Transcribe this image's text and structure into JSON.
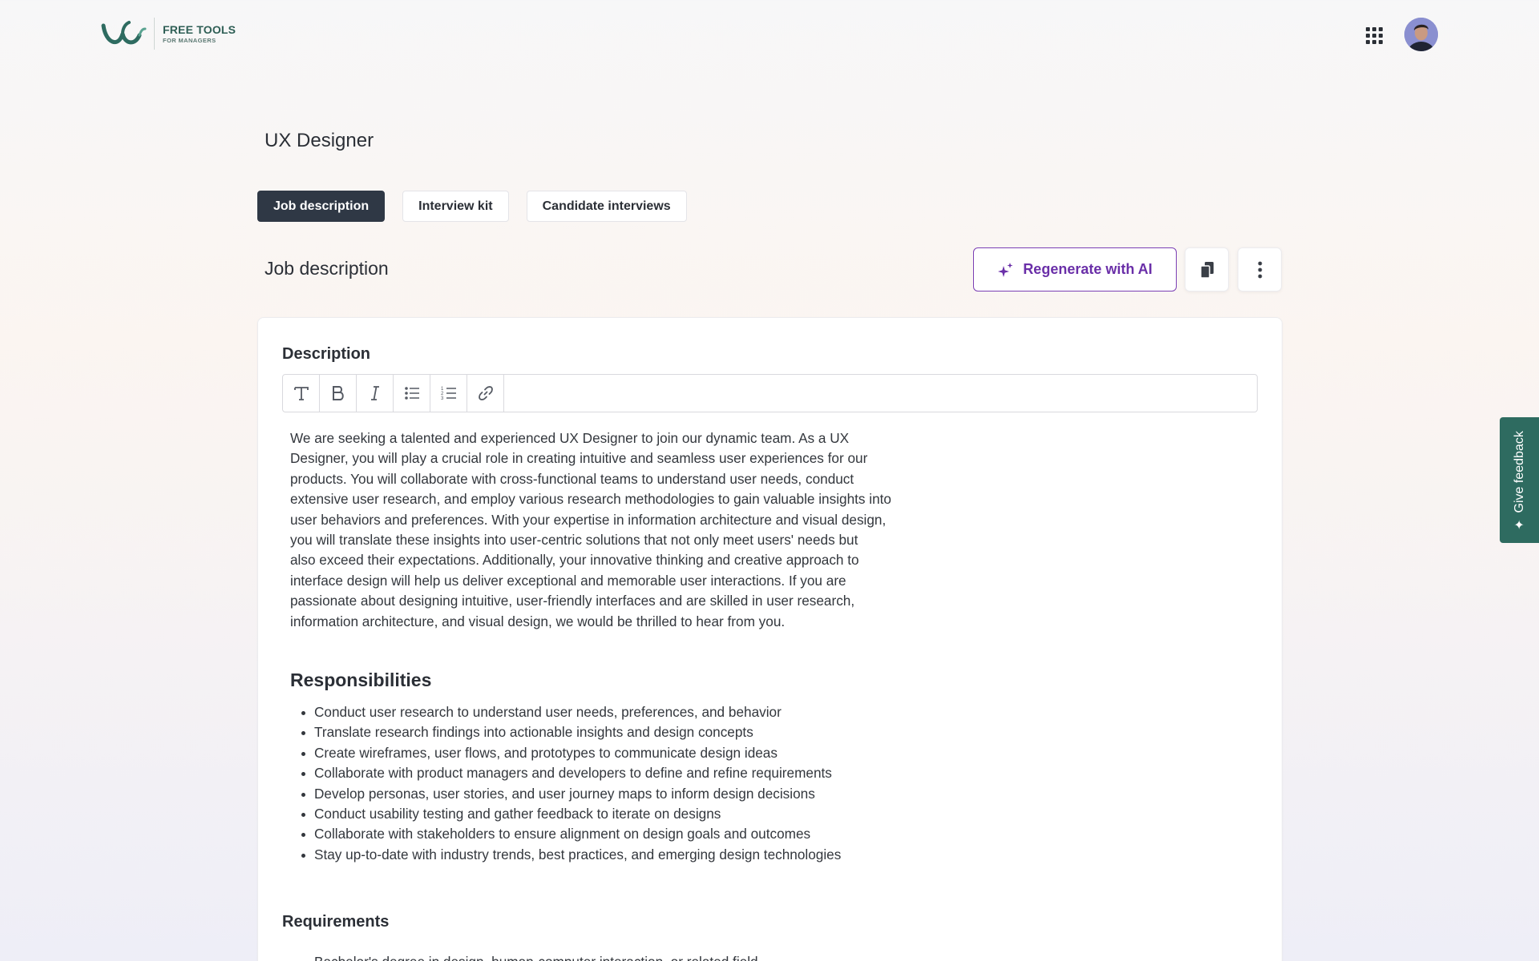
{
  "brand": {
    "title": "FREE TOOLS",
    "subtitle": "FOR MANAGERS",
    "color": "#2e6b60"
  },
  "header": {
    "apps_icon": "grid-icon",
    "avatar": "user-avatar"
  },
  "page": {
    "title": "UX Designer"
  },
  "tabs": [
    {
      "label": "Job description",
      "active": true
    },
    {
      "label": "Interview kit",
      "active": false
    },
    {
      "label": "Candidate interviews",
      "active": false
    }
  ],
  "section": {
    "title": "Job description",
    "regenerate_label": "Regenerate with AI",
    "accent": "#6a2fa8"
  },
  "editor": {
    "label": "Description",
    "toolbar": [
      "text-style-icon",
      "bold-icon",
      "italic-icon",
      "bullet-list-icon",
      "numbered-list-icon",
      "link-icon"
    ],
    "intro_lines": [
      "We are seeking a talented and experienced UX Designer to join our dynamic team. As a UX",
      "Designer, you will play a crucial role in creating intuitive and seamless user experiences for our",
      "products. You will collaborate with cross-functional teams to understand user needs, conduct",
      "extensive user research, and employ various research methodologies to gain valuable insights into",
      "user behaviors and preferences. With your expertise in information architecture and visual design,",
      "you will translate these insights into user-centric solutions that not only meet users' needs but",
      "also exceed their expectations. Additionally, your innovative thinking and creative approach to",
      "interface design will help us deliver exceptional and memorable user interactions. If you are",
      "passionate about designing intuitive, user-friendly interfaces and are skilled in user research,",
      "information architecture, and visual design, we would be thrilled to hear from you."
    ],
    "responsibilities_title": "Responsibilities",
    "responsibilities": [
      "Conduct user research to understand user needs, preferences, and behavior",
      "Translate research findings into actionable insights and design concepts",
      "Create wireframes, user flows, and prototypes to communicate design ideas",
      "Collaborate with product managers and developers to define and refine requirements",
      "Develop personas, user stories, and user journey maps to inform design decisions",
      "Conduct usability testing and gather feedback to iterate on designs",
      "Collaborate with stakeholders to ensure alignment on design goals and outcomes",
      "Stay up-to-date with industry trends, best practices, and emerging design technologies"
    ],
    "requirements_title": "Requirements",
    "requirements": [
      "Bachelor's degree in design, human-computer interaction, or related field"
    ]
  },
  "feedback": {
    "label": "Give feedback"
  }
}
